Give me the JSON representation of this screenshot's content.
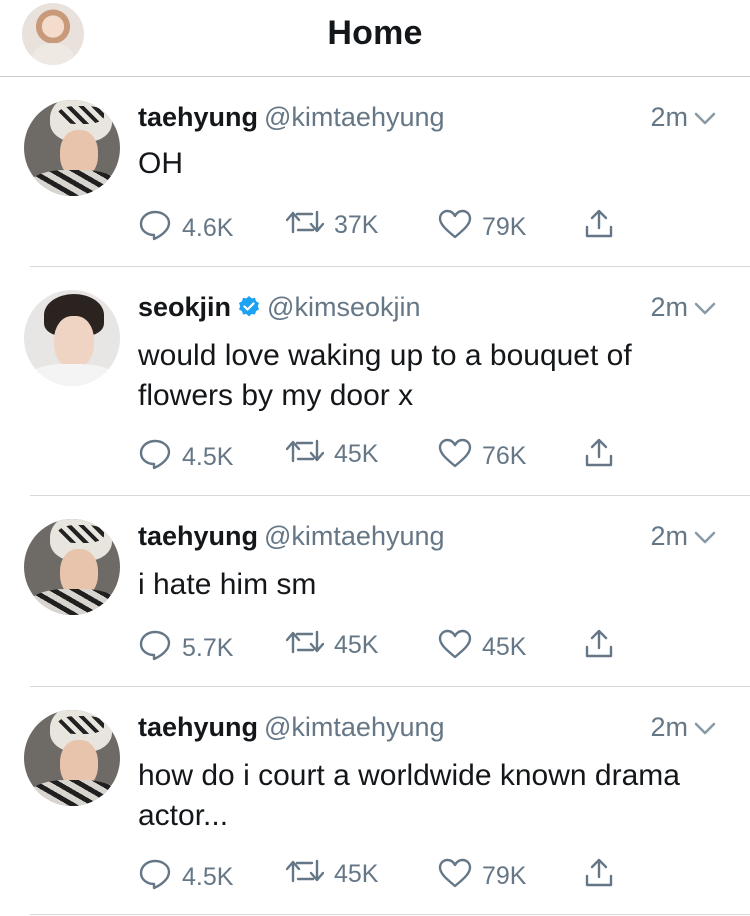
{
  "header": {
    "title": "Home"
  },
  "tweets": [
    {
      "name": "taehyung",
      "handle": "@kimtaehyung",
      "verified": false,
      "time": "2m",
      "text": "OH",
      "replies": "4.6K",
      "retweets": "37K",
      "likes": "79K"
    },
    {
      "name": "seokjin",
      "handle": "@kimseokjin",
      "verified": true,
      "time": "2m",
      "text": "would love waking up to a bouquet of flowers by my door x",
      "replies": "4.5K",
      "retweets": "45K",
      "likes": "76K"
    },
    {
      "name": "taehyung",
      "handle": "@kimtaehyung",
      "verified": false,
      "time": "2m",
      "text": "i hate him sm",
      "replies": "5.7K",
      "retweets": "45K",
      "likes": "45K"
    },
    {
      "name": "taehyung",
      "handle": "@kimtaehyung",
      "verified": false,
      "time": "2m",
      "text": "how do i court a worldwide known drama actor...",
      "replies": "4.5K",
      "retweets": "45K",
      "likes": "79K"
    }
  ],
  "icons": {
    "reply": "reply-icon",
    "retweet": "retweet-icon",
    "like": "heart-icon",
    "share": "share-icon",
    "more": "chevron-down-icon",
    "verified": "verified-badge-icon"
  },
  "colors": {
    "text": "#14171a",
    "secondary": "#657786",
    "verified": "#1da1f2"
  }
}
